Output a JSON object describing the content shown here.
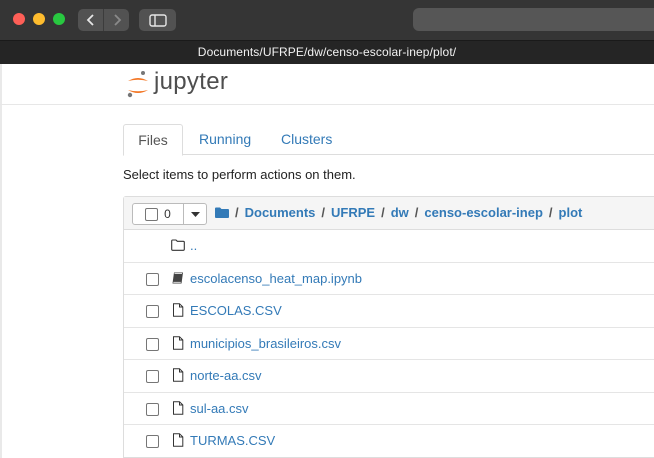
{
  "window": {
    "tab_title": "Documents/UFRPE/dw/censo-escolar-inep/plot/"
  },
  "logo": {
    "text": "jupyter"
  },
  "tabs": [
    {
      "label": "Files"
    },
    {
      "label": "Running"
    },
    {
      "label": "Clusters"
    }
  ],
  "hint": "Select items to perform actions on them.",
  "toolbar": {
    "selected_count": "0"
  },
  "breadcrumb": {
    "separator": "/",
    "items": [
      "Documents",
      "UFRPE",
      "dw",
      "censo-escolar-inep",
      "plot"
    ]
  },
  "files": [
    {
      "name": "..",
      "icon": "folder-icon"
    },
    {
      "name": "escolacenso_heat_map.ipynb",
      "icon": "notebook-icon"
    },
    {
      "name": "ESCOLAS.CSV",
      "icon": "file-icon"
    },
    {
      "name": "municipios_brasileiros.csv",
      "icon": "file-icon"
    },
    {
      "name": "norte-aa.csv",
      "icon": "file-icon"
    },
    {
      "name": "sul-aa.csv",
      "icon": "file-icon"
    },
    {
      "name": "TURMAS.CSV",
      "icon": "file-icon"
    }
  ],
  "colors": {
    "link": "#337ab7",
    "titlebar": "#353535",
    "logo_orange": "#f37726"
  }
}
